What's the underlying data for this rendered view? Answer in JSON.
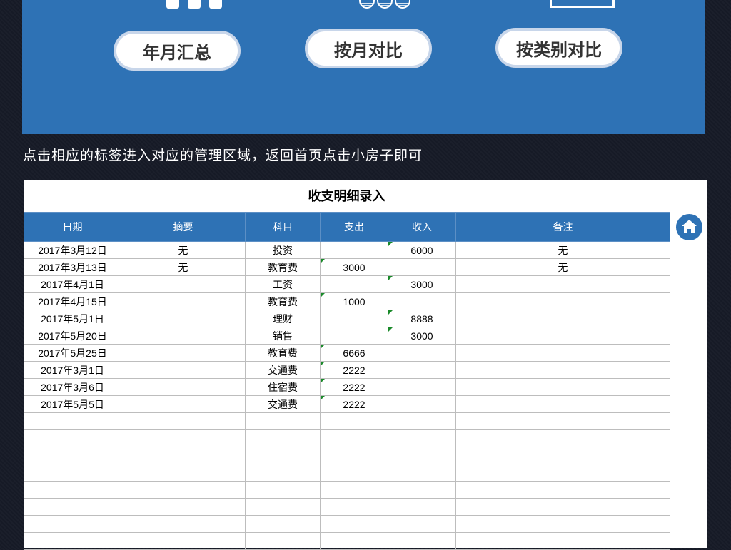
{
  "buttons": {
    "summary": "年月汇总",
    "monthly": "按月对比",
    "category": "按类别对比"
  },
  "hint": "点击相应的标签进入对应的管理区域，返回首页点击小房子即可",
  "sheet": {
    "title": "收支明细录入",
    "columns": [
      "日期",
      "摘要",
      "科目",
      "支出",
      "收入",
      "备注"
    ],
    "rows": [
      [
        "2017年3月12日",
        "无",
        "投资",
        "",
        "6000",
        "无"
      ],
      [
        "2017年3月13日",
        "无",
        "教育费",
        "3000",
        "",
        "无"
      ],
      [
        "2017年4月1日",
        "",
        "工资",
        "",
        "3000",
        ""
      ],
      [
        "2017年4月15日",
        "",
        "教育费",
        "1000",
        "",
        ""
      ],
      [
        "2017年5月1日",
        "",
        "理财",
        "",
        "8888",
        ""
      ],
      [
        "2017年5月20日",
        "",
        "销售",
        "",
        "3000",
        ""
      ],
      [
        "2017年5月25日",
        "",
        "教育费",
        "6666",
        "",
        ""
      ],
      [
        "2017年3月1日",
        "",
        "交通费",
        "2222",
        "",
        ""
      ],
      [
        "2017年3月6日",
        "",
        "住宿费",
        "2222",
        "",
        ""
      ],
      [
        "2017年5月5日",
        "",
        "交通费",
        "2222",
        "",
        ""
      ]
    ],
    "empty_rows": 8
  },
  "icons": {
    "home": "home-icon"
  },
  "colors": {
    "banner": "#2e72b5",
    "header": "#2e72b5",
    "background": "#161a26",
    "cell_flag": "#1a8a2a"
  }
}
